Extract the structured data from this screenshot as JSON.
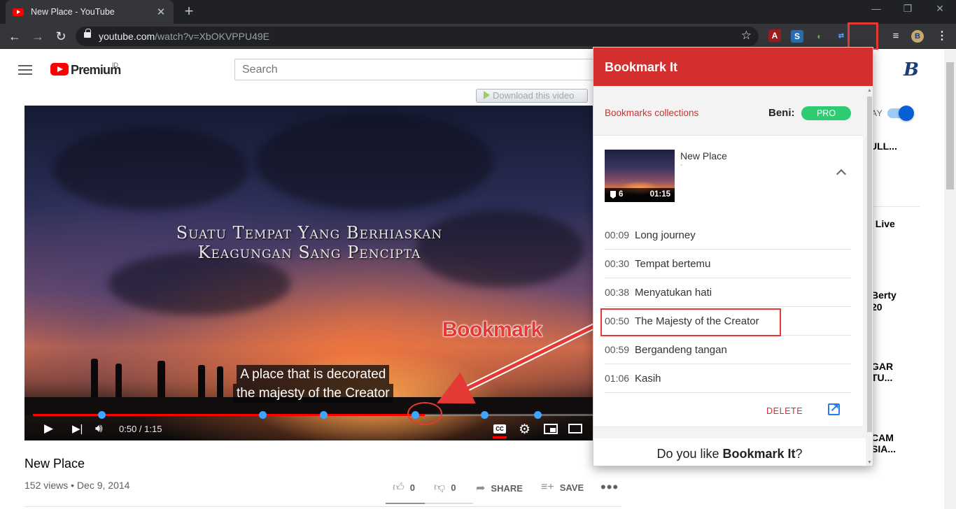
{
  "browser": {
    "tab_title": "New Place - YouTube",
    "tab_close": "✕",
    "new_tab": "+",
    "url_host": "youtube.com",
    "url_path": "/watch?v=XbOKVPPU49E",
    "window_min": "—",
    "window_restore": "❐",
    "window_close": "✕"
  },
  "youtube": {
    "logo_text": "Premium",
    "logo_region": "ID",
    "search_placeholder": "Search",
    "avatar_letter": "B",
    "download_button": "Download this video",
    "autoplay_label": "AY",
    "sidebar_fragments": [
      "ULL...",
      "/ Live",
      "Berty",
      "20",
      "GAR",
      "TU...",
      "CAM",
      "SIA..."
    ]
  },
  "player": {
    "overlay_line1": "Suatu Tempat Yang Berhiaskan",
    "overlay_line2": "Keagungan Sang Pencipta",
    "caption_line1": "A place that is decorated",
    "caption_line2": "the majesty of the Creator",
    "current_time": "0:50",
    "duration": "1:15",
    "time_readout": "0:50 / 1:15",
    "progress_fraction": 0.684,
    "cc_label": "CC",
    "bookmark_marker_seconds": [
      9,
      30,
      38,
      50,
      59,
      66
    ]
  },
  "video": {
    "title": "New Place",
    "meta": "152 views • Dec 9, 2014",
    "likes": "0",
    "dislikes": "0",
    "share_label": "SHARE",
    "save_label": "SAVE",
    "more": "•••"
  },
  "annotation": {
    "label": "Bookmark"
  },
  "extension": {
    "header_title": "Bookmark It",
    "collections_link": "Bookmarks collections",
    "user_name": "Beni:",
    "plan_badge": "PRO",
    "video_title": "New Place",
    "video_subtitle": "-",
    "bookmark_count": "6",
    "video_duration": "01:15",
    "bookmarks": [
      {
        "time": "00:09",
        "label": "Long journey"
      },
      {
        "time": "00:30",
        "label": "Tempat bertemu"
      },
      {
        "time": "00:38",
        "label": "Menyatukan hati"
      },
      {
        "time": "00:50",
        "label": "The Majesty of the Creator"
      },
      {
        "time": "00:59",
        "label": "Bergandeng tangan"
      },
      {
        "time": "01:06",
        "label": "Kasih"
      }
    ],
    "delete_label": "DELETE",
    "promo_prefix": "Do you like ",
    "promo_name": "Bookmark It",
    "promo_suffix": "?"
  },
  "colors": {
    "accent_red": "#d32f2f",
    "pro_green": "#2ecc71",
    "marker_blue": "#3ea6ff",
    "progress_red": "#ff0000"
  }
}
